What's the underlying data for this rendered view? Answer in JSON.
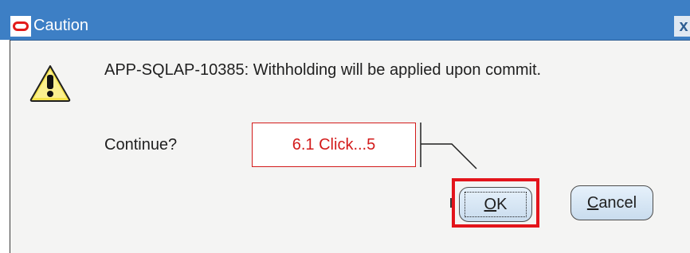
{
  "window": {
    "title": "Caution",
    "close_symbol": "x",
    "logo": "oracle-logo"
  },
  "dialog": {
    "message": "APP-SQLAP-10385: Withholding will be applied upon commit.",
    "question": "Continue?",
    "icon": "warning-icon"
  },
  "buttons": {
    "ok_mnemonic": "O",
    "ok_rest": "K",
    "cancel_mnemonic": "C",
    "cancel_rest": "ancel"
  },
  "annotation": {
    "callout_text": "6.1 Click...5",
    "color": "#e3141b"
  },
  "colors": {
    "titlebar": "#3d7fc5",
    "dialog_bg": "#f4f4f3",
    "button_bg": "#d8e7f5"
  }
}
